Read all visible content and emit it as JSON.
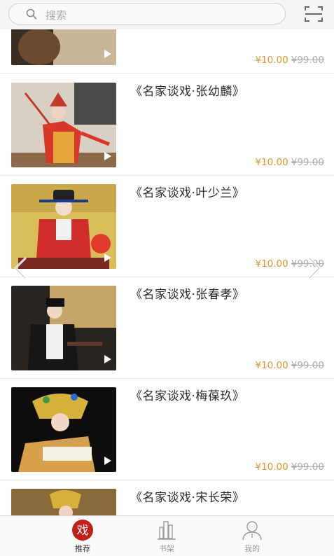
{
  "search": {
    "placeholder": "搜索",
    "search_icon": "search-icon",
    "scan_icon": "scan-icon"
  },
  "items": [
    {
      "title": "",
      "price": "¥10.00",
      "original_price": "¥99.00"
    },
    {
      "title": "《名家谈戏·张幼麟》",
      "price": "¥10.00",
      "original_price": "¥99.00"
    },
    {
      "title": "《名家谈戏·叶少兰》",
      "price": "¥10.00",
      "original_price": "¥99.00"
    },
    {
      "title": "《名家谈戏·张春孝》",
      "price": "¥10.00",
      "original_price": "¥99.00"
    },
    {
      "title": "《名家谈戏·梅葆玖》",
      "price": "¥10.00",
      "original_price": "¥99.00"
    },
    {
      "title": "《名家谈戏·宋长荣》",
      "price": "",
      "original_price": ""
    }
  ],
  "carousel": {
    "left_icon": "chevron-left-icon",
    "right_icon": "chevron-right-icon"
  },
  "tabbar": {
    "tabs": [
      {
        "label": "推荐",
        "icon": "opera-logo-icon",
        "glyph": "戏",
        "active": true
      },
      {
        "label": "书架",
        "icon": "bookshelf-icon",
        "active": false
      },
      {
        "label": "我的",
        "icon": "user-icon",
        "active": false
      }
    ]
  },
  "colors": {
    "price": "#e0952c",
    "original_price": "#a9a9a9",
    "accent": "#c0201c"
  }
}
